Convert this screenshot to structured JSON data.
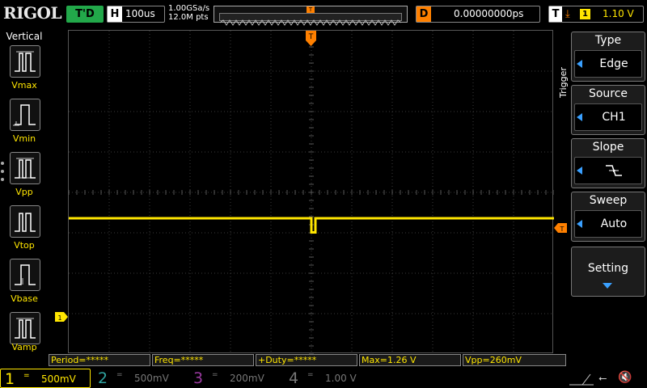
{
  "topbar": {
    "logo": "RIGOL",
    "run_status": "T'D",
    "horizontal": {
      "label": "H",
      "value": "100us"
    },
    "sample_rate": "1.00GSa/s",
    "memory_depth": "12.0M pts",
    "memory_trigger_marker": "T",
    "delay": {
      "label": "D",
      "value": "0.00000000ps"
    },
    "trigger": {
      "label": "T",
      "edge_icon": "falling-edge-icon",
      "source": "1",
      "level": "1.10 V"
    }
  },
  "left_menu": {
    "title": "Vertical",
    "items": [
      {
        "label": "Vmax",
        "icon": "vmax-icon"
      },
      {
        "label": "Vmin",
        "icon": "vmin-icon"
      },
      {
        "label": "Vpp",
        "icon": "vpp-icon"
      },
      {
        "label": "Vtop",
        "icon": "vtop-icon"
      },
      {
        "label": "Vbase",
        "icon": "vbase-icon"
      },
      {
        "label": "Vamp",
        "icon": "vamp-icon"
      }
    ]
  },
  "screen": {
    "trigger_position_marker": "T",
    "trigger_level_marker": "T",
    "channel_marker": "1"
  },
  "right_menu": {
    "title": "Trigger",
    "keys": [
      {
        "title": "Type",
        "value": "Edge"
      },
      {
        "title": "Source",
        "value": "CH1"
      },
      {
        "title": "Slope",
        "value": ""
      },
      {
        "title": "Sweep",
        "value": "Auto"
      }
    ],
    "setting": "Setting"
  },
  "results": [
    {
      "text": "Period=*****"
    },
    {
      "text": "Freq=*****"
    },
    {
      "text": "+Duty=*****"
    },
    {
      "text": "Max=1.26 V"
    },
    {
      "text": "Vpp=260mV"
    }
  ],
  "channels": [
    {
      "number": "1",
      "scale": "500mV",
      "coupling": "="
    },
    {
      "number": "2",
      "scale": "500mV",
      "coupling": "="
    },
    {
      "number": "3",
      "scale": "200mV",
      "coupling": "="
    },
    {
      "number": "4",
      "scale": "1.00 V",
      "coupling": "="
    }
  ],
  "colors": {
    "ch1": "#ffe600",
    "ch2": "#2fa3a0",
    "ch3": "#9a3aa0",
    "trigger": "#ff8000",
    "run": "#22a84a",
    "accent": "#3aa0ff"
  },
  "waveform": {
    "baseline_div": 0.2,
    "pulse_depth_div": 0.5,
    "pulse_start_div": 0.0,
    "pulse_width_div": 0.1
  }
}
